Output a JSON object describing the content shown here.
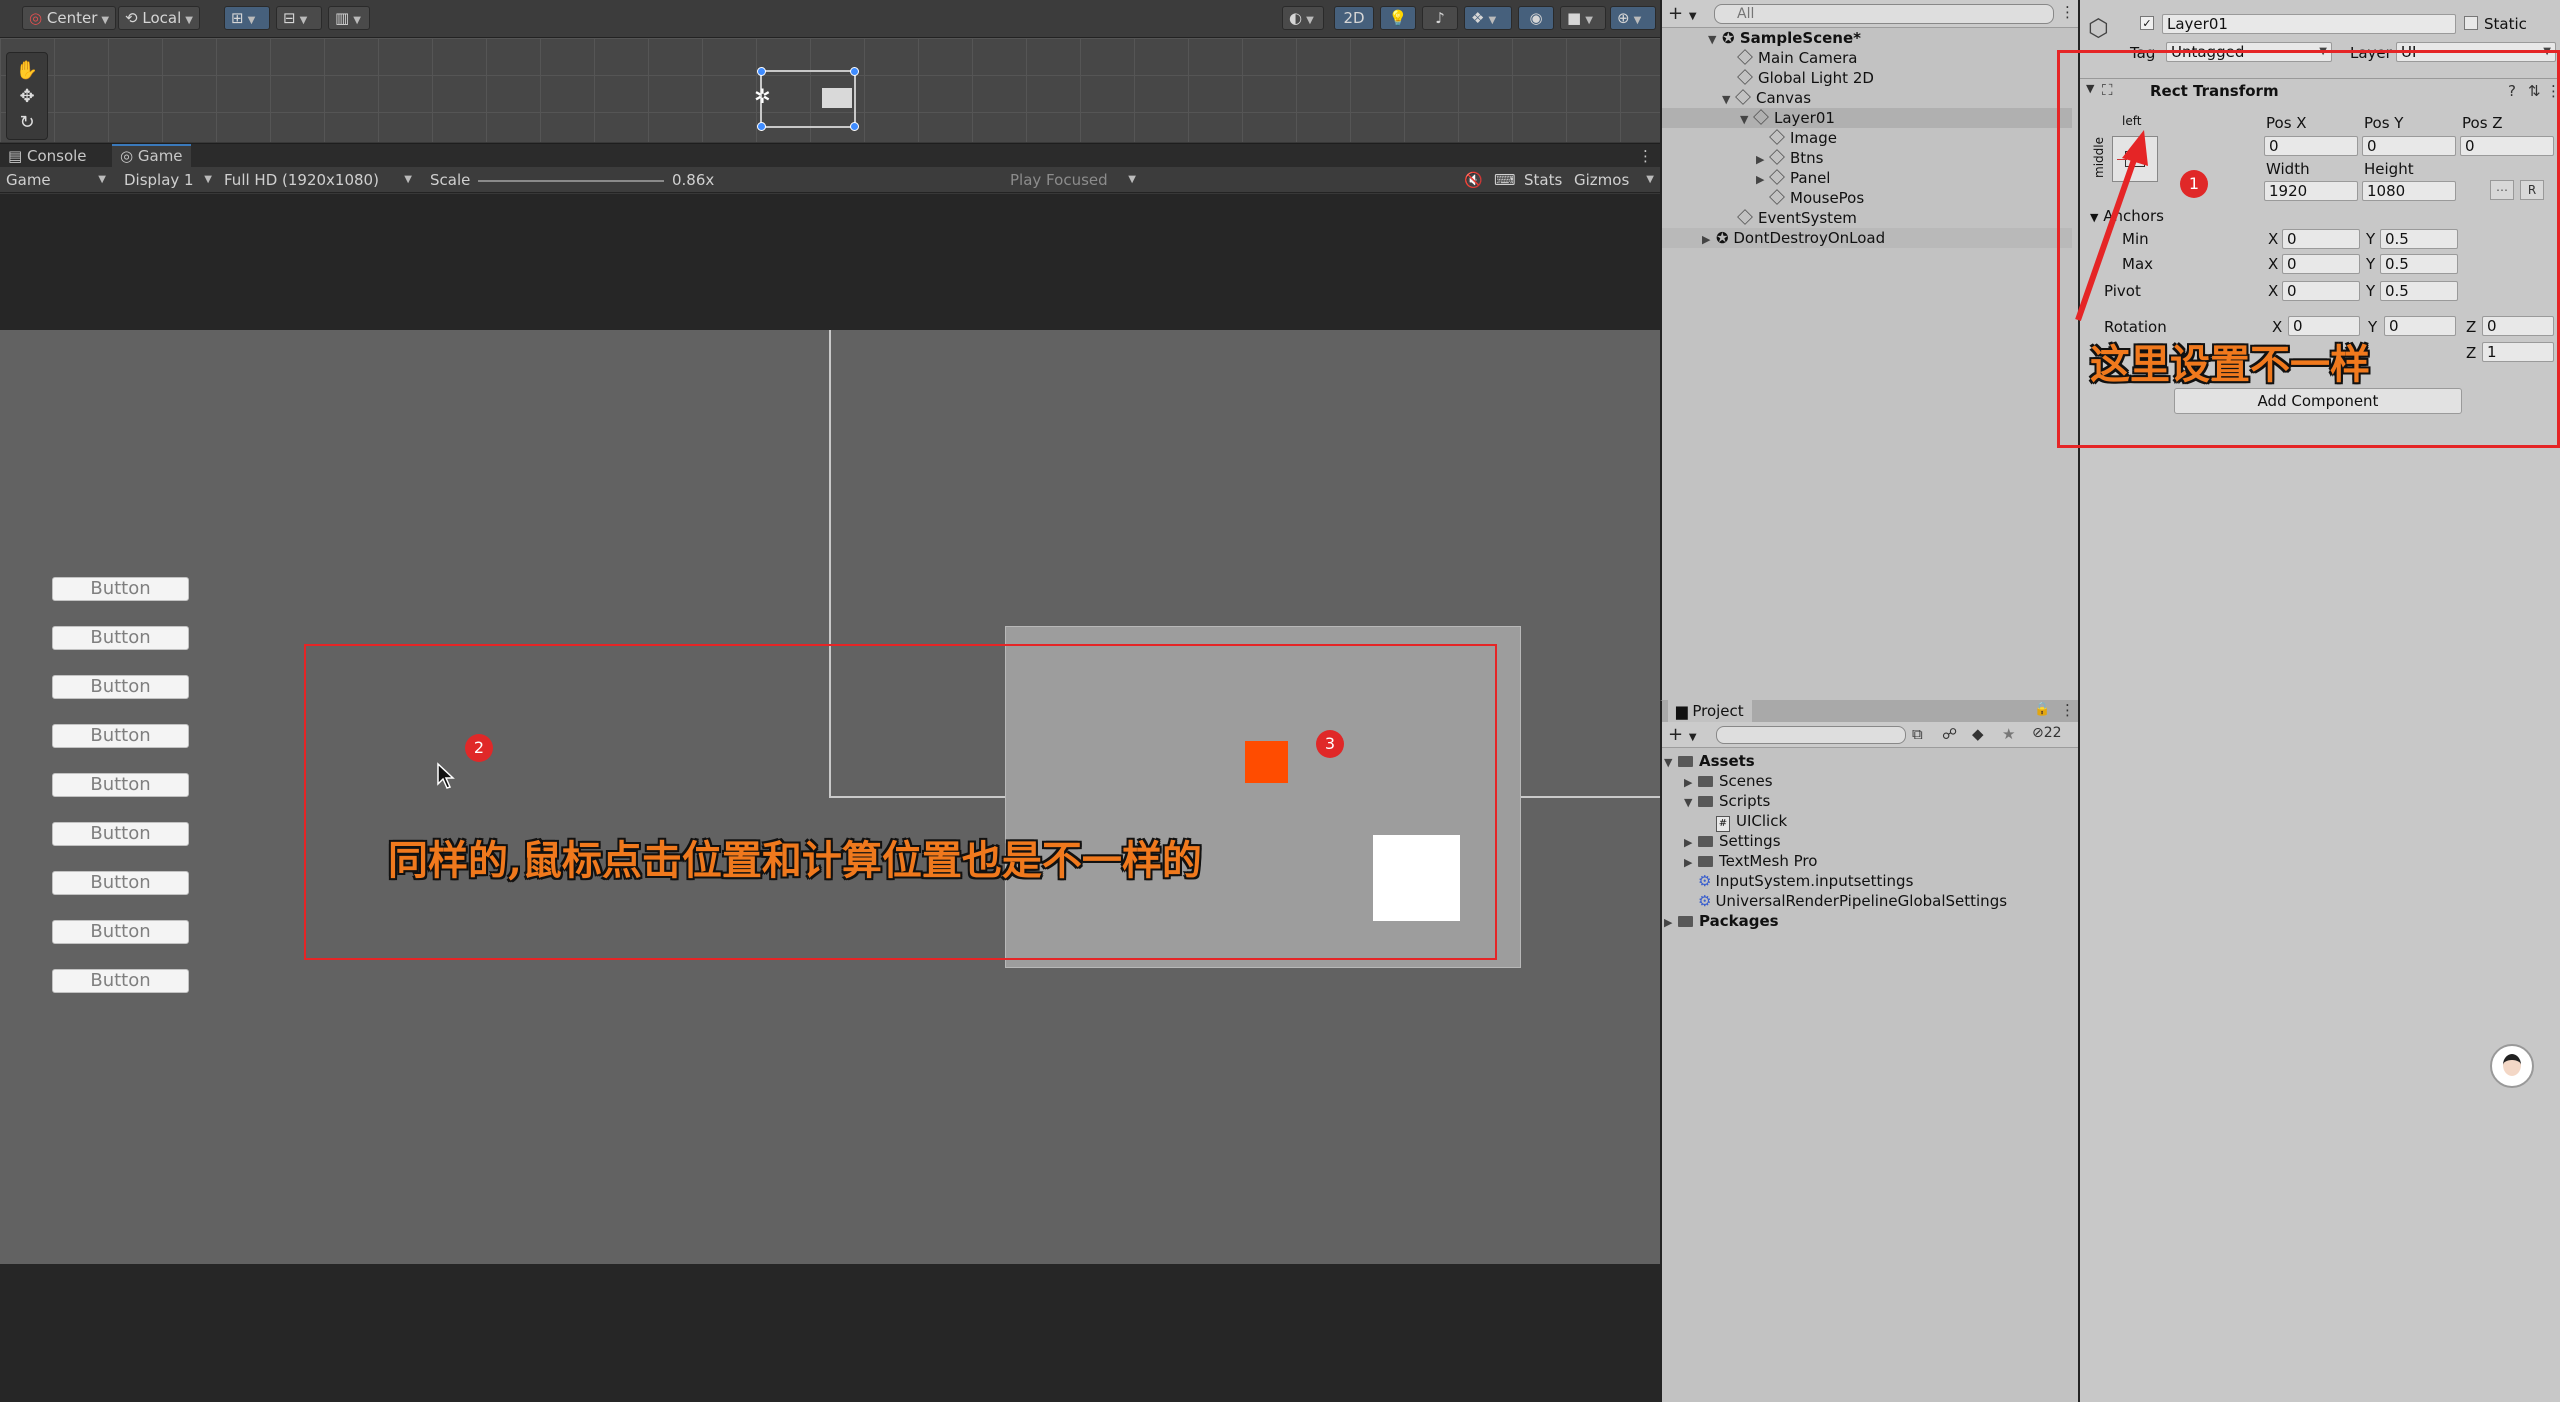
{
  "scene_toolbar": {
    "pivot_mode": "Center",
    "pivot_rotation": "Local",
    "toggle_2d": "2D"
  },
  "tabs": {
    "console": "Console",
    "game": "Game"
  },
  "game_toolbar": {
    "view": "Game",
    "display": "Display 1",
    "resolution": "Full HD (1920x1080)",
    "scale_label": "Scale",
    "scale_value": "0.86x",
    "play_mode": "Play Focused",
    "stats": "Stats",
    "gizmos": "Gizmos"
  },
  "game": {
    "buttons": [
      "Button",
      "Button",
      "Button",
      "Button",
      "Button",
      "Button",
      "Button",
      "Button",
      "Button"
    ],
    "annotation_text": "同样的,鼠标点击位置和计算位置也是不一样的",
    "badge_2": "2",
    "badge_3": "3"
  },
  "hierarchy": {
    "search_placeholder": "All",
    "items": [
      {
        "label": "SampleScene*",
        "kind": "scene"
      },
      {
        "label": "Main Camera",
        "kind": "object"
      },
      {
        "label": "Global Light 2D",
        "kind": "object"
      },
      {
        "label": "Canvas",
        "kind": "object"
      },
      {
        "label": "Layer01",
        "kind": "object",
        "selected": true
      },
      {
        "label": "Image",
        "kind": "object"
      },
      {
        "label": "Btns",
        "kind": "object"
      },
      {
        "label": "Panel",
        "kind": "object"
      },
      {
        "label": "MousePos",
        "kind": "object"
      },
      {
        "label": "EventSystem",
        "kind": "object"
      },
      {
        "label": "DontDestroyOnLoad",
        "kind": "scene"
      }
    ]
  },
  "project": {
    "tab": "Project",
    "count": "22",
    "items": [
      {
        "label": "Assets",
        "kind": "folder"
      },
      {
        "label": "Scenes",
        "kind": "folder"
      },
      {
        "label": "Scripts",
        "kind": "folder"
      },
      {
        "label": "UIClick",
        "kind": "script"
      },
      {
        "label": "Settings",
        "kind": "folder"
      },
      {
        "label": "TextMesh Pro",
        "kind": "folder"
      },
      {
        "label": "InputSystem.inputsettings",
        "kind": "asset"
      },
      {
        "label": "UniversalRenderPipelineGlobalSettings",
        "kind": "asset"
      },
      {
        "label": "Packages",
        "kind": "folder"
      }
    ]
  },
  "inspector": {
    "object_name": "Layer01",
    "static_label": "Static",
    "tag_label": "Tag",
    "tag_value": "Untagged",
    "layer_label": "Layer",
    "layer_value": "UI",
    "component": "Rect Transform",
    "anchor_h": "left",
    "anchor_v": "middle",
    "posx_label": "Pos X",
    "posy_label": "Pos Y",
    "posz_label": "Pos Z",
    "posx": "0",
    "posy": "0",
    "posz": "0",
    "width_label": "Width",
    "height_label": "Height",
    "width": "1920",
    "height": "1080",
    "raw_button": "R",
    "anchors_label": "Anchors",
    "min_label": "Min",
    "max_label": "Max",
    "pivot_label": "Pivot",
    "x_label": "X",
    "y_label": "Y",
    "z_label": "Z",
    "min_x": "0",
    "min_y": "0.5",
    "max_x": "0",
    "max_y": "0.5",
    "pivot_x": "0",
    "pivot_y": "0.5",
    "rotation_label": "Rotation",
    "rot_x": "0",
    "rot_y": "0",
    "rot_z": "0",
    "scale_z": "1",
    "annotation_text": "这里设置不一样",
    "badge_1": "1",
    "add_component": "Add Component"
  }
}
